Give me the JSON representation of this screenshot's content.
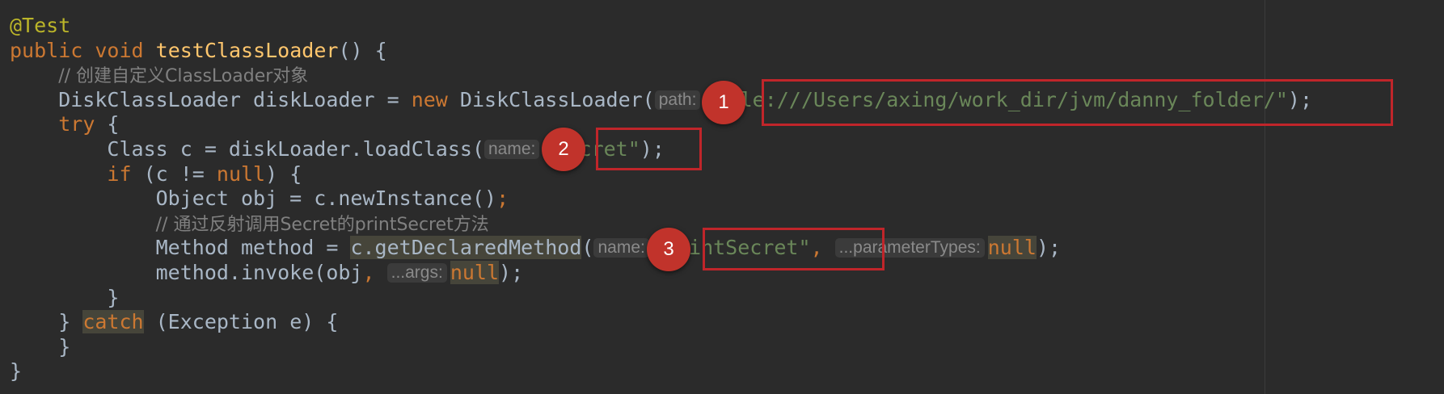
{
  "code_lines": [
    [
      {
        "t": "@Test",
        "c": "ann"
      }
    ],
    [
      {
        "t": "public",
        "c": "kw"
      },
      {
        "t": " "
      },
      {
        "t": "void",
        "c": "kw"
      },
      {
        "t": " "
      },
      {
        "t": "testClassLoader",
        "c": "fn"
      },
      {
        "t": "() {"
      }
    ],
    [
      {
        "t": "    "
      },
      {
        "t": "// 创建自定义ClassLoader对象",
        "c": "cmt"
      }
    ],
    [
      {
        "t": "    DiskClassLoader diskLoader = "
      },
      {
        "t": "new",
        "c": "kw"
      },
      {
        "t": " DiskClassLoader("
      },
      {
        "h": "path:"
      },
      {
        "t": "\"file:///Users/axing/work_dir/jvm/danny_folder/\"",
        "c": "str"
      },
      {
        "t": ");"
      }
    ],
    [
      {
        "t": "    "
      },
      {
        "t": "try",
        "c": "kw"
      },
      {
        "t": " {"
      }
    ],
    [
      {
        "t": "        Class c = diskLoader.loadClass("
      },
      {
        "h": "name:"
      },
      {
        "t": "\"Secret\"",
        "c": "str"
      },
      {
        "t": ");"
      }
    ],
    [
      {
        "t": "        "
      },
      {
        "t": "if",
        "c": "kw"
      },
      {
        "t": " (c != "
      },
      {
        "t": "null",
        "c": "kw"
      },
      {
        "t": ") {"
      }
    ],
    [
      {
        "t": "            Object obj = c.newInstance()"
      },
      {
        "t": ";",
        "c": "kw"
      }
    ],
    [
      {
        "t": "            "
      },
      {
        "t": "// 通过反射调用Secret的printSecret方法",
        "c": "cmt"
      }
    ],
    [
      {
        "t": "            Method method = "
      },
      {
        "t": "c.getDeclaredMethod",
        "c": "hl"
      },
      {
        "t": "("
      },
      {
        "h": "name:"
      },
      {
        "t": "\"printSecret\"",
        "c": "str"
      },
      {
        "t": ", ",
        "c": "kw"
      },
      {
        "h": "...parameterTypes:"
      },
      {
        "t": "null",
        "c": "kw hl"
      },
      {
        "t": ");"
      }
    ],
    [
      {
        "t": "            method.invoke(obj"
      },
      {
        "t": ", ",
        "c": "kw"
      },
      {
        "h": "...args:"
      },
      {
        "t": "null",
        "c": "kw hl"
      },
      {
        "t": ");"
      }
    ],
    [
      {
        "t": "        }"
      }
    ],
    [
      {
        "t": "    } "
      },
      {
        "t": "catch",
        "c": "kw hl"
      },
      {
        "t": " (Exception e) {"
      }
    ],
    [
      {
        "t": "    }"
      }
    ],
    [
      {
        "t": "}"
      }
    ]
  ],
  "annotations": [
    {
      "number": "1",
      "target": "\"file:///Users/axing/work_dir/jvm/danny_folder/\""
    },
    {
      "number": "2",
      "target": "\"Secret\""
    },
    {
      "number": "3",
      "target": "\"printSecret\""
    }
  ],
  "colors": {
    "background": "#2b2b2b",
    "keyword": "#cc7832",
    "string": "#6a8759",
    "method_declaration": "#ffc66d",
    "annotation": "#bbb529",
    "comment": "#808080",
    "default_text": "#a9b7c6",
    "highlight_box": "#c0252a",
    "badge": "#c1332b"
  }
}
